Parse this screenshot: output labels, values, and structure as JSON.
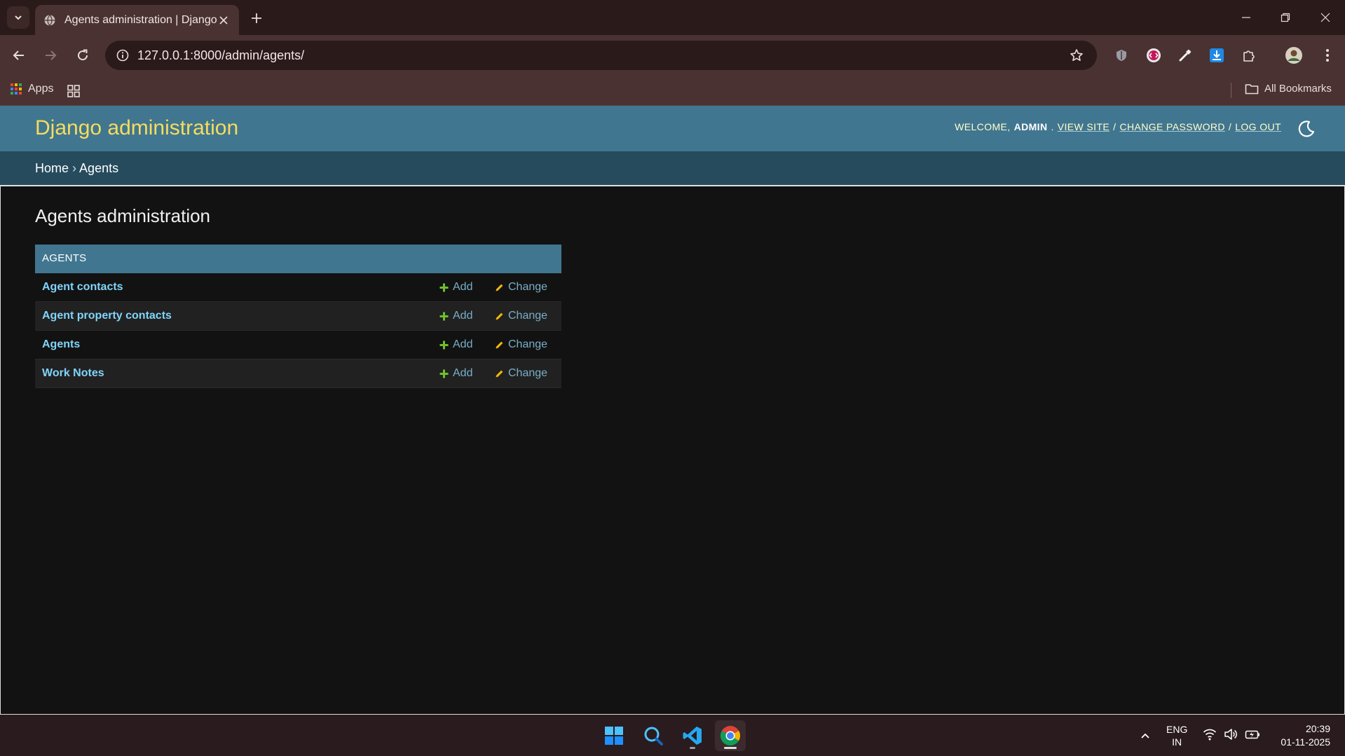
{
  "browser": {
    "tab_title": "Agents administration | Django site admin",
    "url": "127.0.0.1:8000/admin/agents/",
    "bookmarks": {
      "apps_label": "Apps",
      "all_bookmarks_label": "All Bookmarks"
    }
  },
  "admin": {
    "site_title": "Django administration",
    "usertools": {
      "welcome": "Welcome,",
      "username": "admin",
      "view_site": "View site",
      "change_password": "Change password",
      "log_out": "Log out",
      "sep": "/"
    },
    "breadcrumbs": {
      "home": "Home",
      "sep": "›",
      "current": "Agents"
    },
    "page_title": "Agents administration",
    "module": {
      "caption": "Agents",
      "models": [
        {
          "name": "Agent contacts",
          "add": "Add",
          "change": "Change"
        },
        {
          "name": "Agent property contacts",
          "add": "Add",
          "change": "Change"
        },
        {
          "name": "Agents",
          "add": "Add",
          "change": "Change"
        },
        {
          "name": "Work Notes",
          "add": "Add",
          "change": "Change"
        }
      ]
    }
  },
  "taskbar": {
    "lang_line1": "ENG",
    "lang_line2": "IN",
    "time": "20:39",
    "date": "01-11-2025"
  },
  "colors": {
    "header": "#417690",
    "breadcrumbs": "#264b5d",
    "brand": "#f5dd5d",
    "link": "#81d4fa",
    "add_icon": "#70bf2b",
    "change_icon": "#efb80b"
  }
}
